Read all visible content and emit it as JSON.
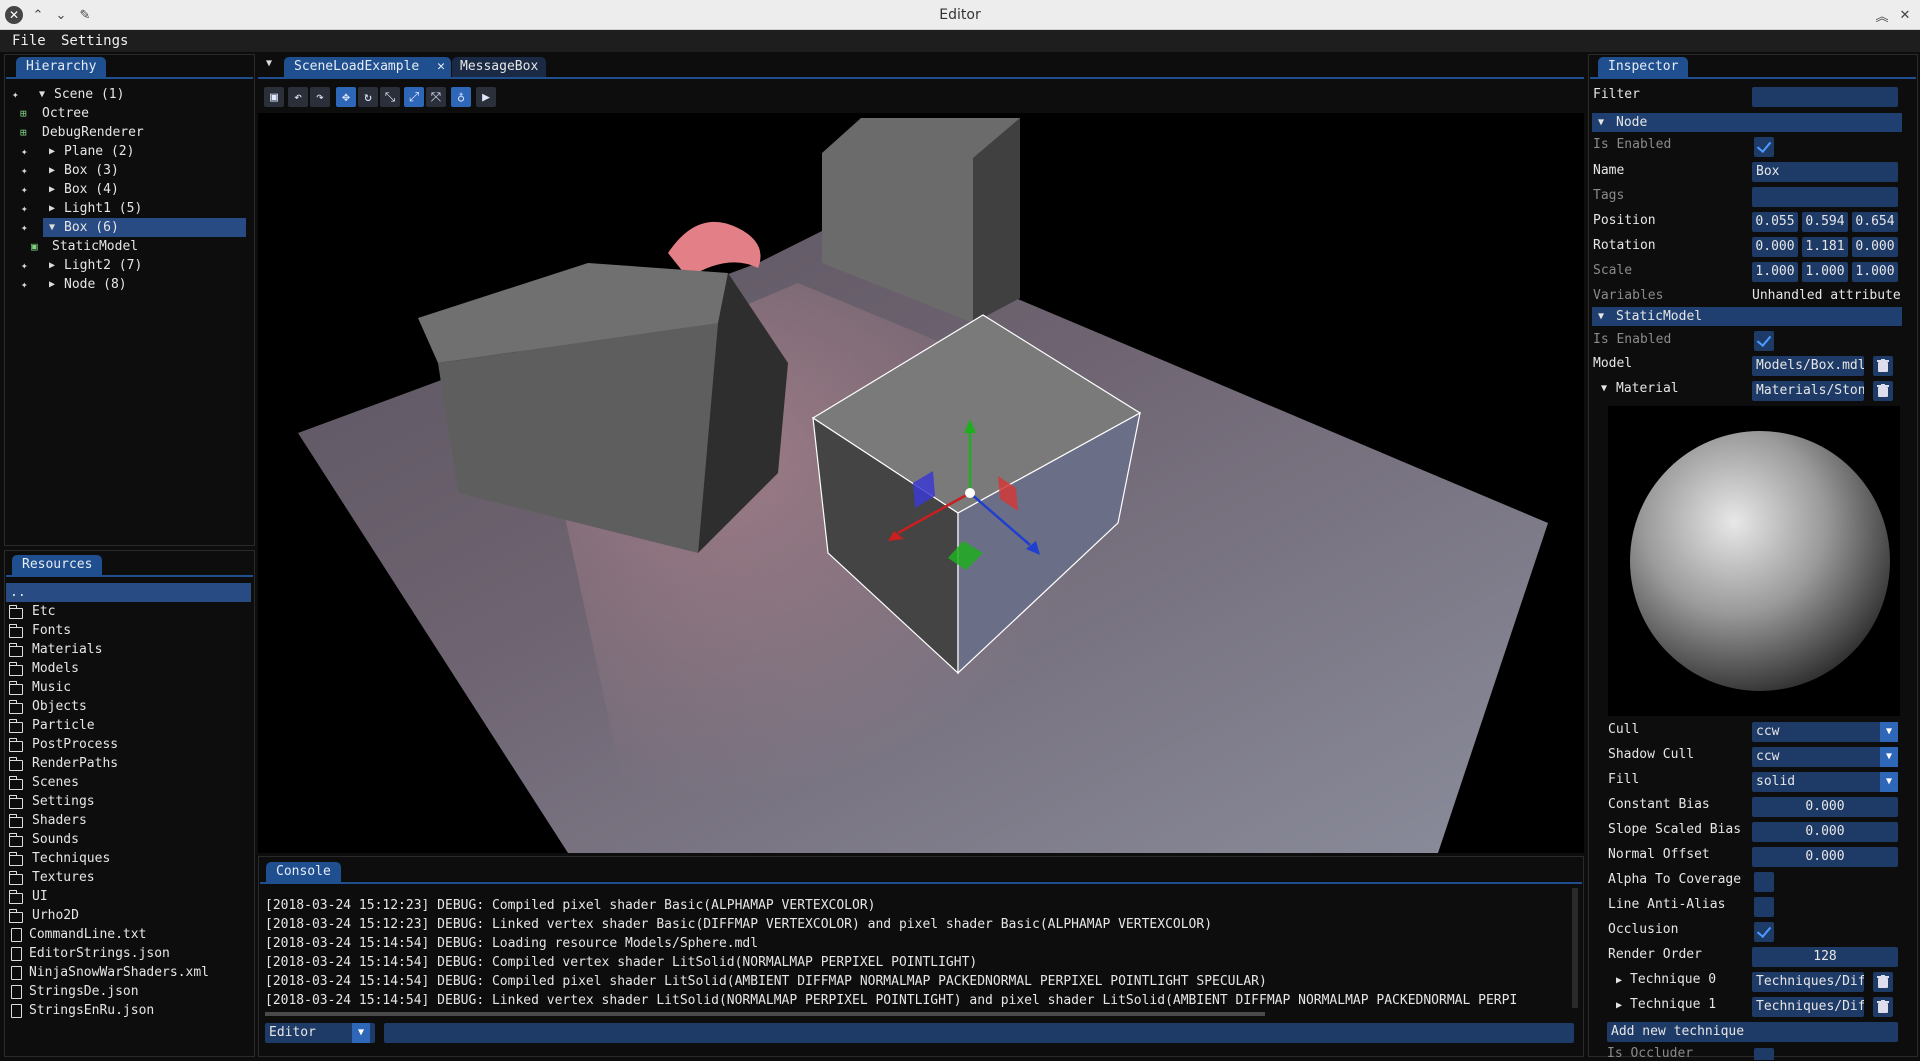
{
  "window": {
    "title": "Editor"
  },
  "menu": {
    "file": "File",
    "settings": "Settings"
  },
  "hierarchy": {
    "tab": "Hierarchy",
    "items": [
      {
        "label": "Scene (1)"
      },
      {
        "label": "Octree"
      },
      {
        "label": "DebugRenderer"
      },
      {
        "label": "Plane (2)"
      },
      {
        "label": "Box (3)"
      },
      {
        "label": "Box (4)"
      },
      {
        "label": "Light1 (5)"
      },
      {
        "label": "Box (6)"
      },
      {
        "label": "StaticModel"
      },
      {
        "label": "Light2 (7)"
      },
      {
        "label": "Node (8)"
      }
    ],
    "selected": "Box (6)"
  },
  "resources": {
    "tab": "Resources",
    "parent": "..",
    "folders": [
      "Etc",
      "Fonts",
      "Materials",
      "Models",
      "Music",
      "Objects",
      "Particle",
      "PostProcess",
      "RenderPaths",
      "Scenes",
      "Settings",
      "Shaders",
      "Sounds",
      "Techniques",
      "Textures",
      "UI",
      "Urho2D"
    ],
    "files": [
      "CommandLine.txt",
      "EditorStrings.json",
      "NinjaSnowWarShaders.xml",
      "StringsDe.json",
      "StringsEnRu.json"
    ]
  },
  "editor_tabs": [
    {
      "label": "SceneLoadExample",
      "close": "✕",
      "active": true
    },
    {
      "label": "MessageBox",
      "active": false
    }
  ],
  "toolbar": {
    "icons": [
      "save-icon",
      "undo-icon",
      "redo-icon",
      "move-icon",
      "rotate-icon",
      "scale-icon",
      "fit-icon",
      "snap-icon",
      "light-icon",
      "play-icon"
    ],
    "active_color": "#2f67b8"
  },
  "console": {
    "tab": "Console",
    "lines": [
      "[2018-03-24 15:12:23] DEBUG:   Compiled pixel shader Basic(ALPHAMAP VERTEXCOLOR)",
      "[2018-03-24 15:12:23] DEBUG:   Linked vertex shader Basic(DIFFMAP VERTEXCOLOR) and pixel shader Basic(ALPHAMAP VERTEXCOLOR)",
      "[2018-03-24 15:14:54] DEBUG:   Loading resource Models/Sphere.mdl",
      "[2018-03-24 15:14:54] DEBUG:   Compiled vertex shader LitSolid(NORMALMAP PERPIXEL POINTLIGHT)",
      "[2018-03-24 15:14:54] DEBUG:   Compiled pixel shader LitSolid(AMBIENT DIFFMAP NORMALMAP PACKEDNORMAL PERPIXEL POINTLIGHT SPECULAR)",
      "[2018-03-24 15:14:54] DEBUG:   Linked vertex shader LitSolid(NORMALMAP PERPIXEL POINTLIGHT) and pixel shader LitSolid(AMBIENT DIFFMAP NORMALMAP PACKEDNORMAL PERPI"
    ],
    "mode": "Editor",
    "command": ""
  },
  "inspector": {
    "tab": "Inspector",
    "filter_label": "Filter",
    "filter_value": "",
    "node": {
      "header": "Node",
      "is_enabled_label": "Is Enabled",
      "name_label": "Name",
      "name_value": "Box",
      "tags_label": "Tags",
      "tags_value": "",
      "position_label": "Position",
      "position": [
        "0.055",
        "0.594",
        "0.654"
      ],
      "rotation_label": "Rotation",
      "rotation": [
        "0.000",
        "1.181",
        "0.000"
      ],
      "scale_label": "Scale",
      "scale": [
        "1.000",
        "1.000",
        "1.000"
      ],
      "variables_label": "Variables",
      "variables_value": "Unhandled attribute"
    },
    "static_model": {
      "header": "StaticModel",
      "is_enabled_label": "Is Enabled",
      "model_label": "Model",
      "model_value": "Models/Box.mdl",
      "material_label": "Material",
      "material_value": "Materials/Stone.xml"
    },
    "material": {
      "cull_label": "Cull",
      "cull": "ccw",
      "shadow_cull_label": "Shadow Cull",
      "shadow_cull": "ccw",
      "fill_label": "Fill",
      "fill": "solid",
      "constant_bias_label": "Constant Bias",
      "constant_bias": "0.000",
      "slope_bias_label": "Slope Scaled Bias",
      "slope_bias": "0.000",
      "normal_offset_label": "Normal Offset",
      "normal_offset": "0.000",
      "alpha_coverage_label": "Alpha To Coverage",
      "line_aa_label": "Line Anti-Alias",
      "occlusion_label": "Occlusion",
      "render_order_label": "Render Order",
      "render_order": "128",
      "technique0_label": "Technique 0",
      "technique0": "Techniques/Diff.xml",
      "technique1_label": "Technique 1",
      "technique1": "Techniques/Diff.xml",
      "add_technique": "Add new technique",
      "is_occluder_label": "Is Occluder"
    }
  }
}
